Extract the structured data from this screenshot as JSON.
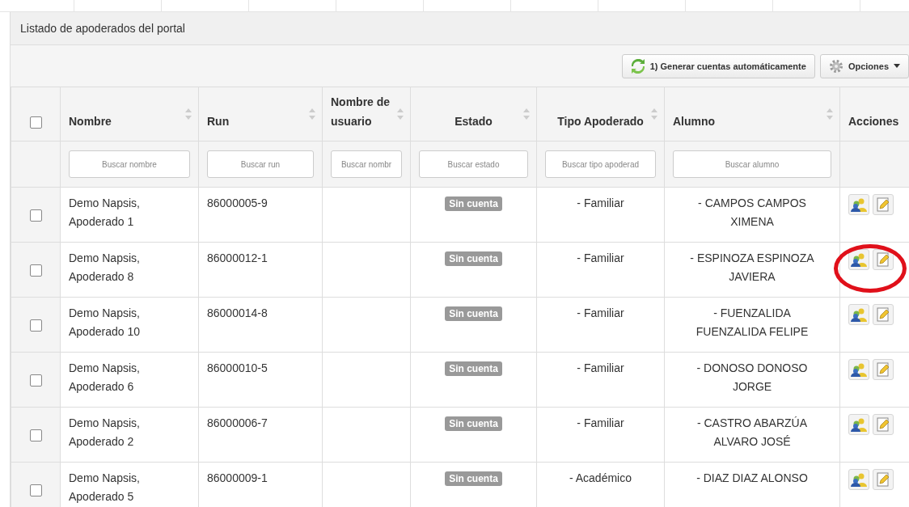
{
  "panel": {
    "title": "Listado de apoderados del portal"
  },
  "toolbar": {
    "buttons": [
      {
        "kind": "generate",
        "label": "1) Generar cuentas automáticamente"
      },
      {
        "kind": "options",
        "label": "Opciones"
      }
    ]
  },
  "table": {
    "select_all": {
      "checked": false
    },
    "columns": [
      {
        "label": "Nombre",
        "sortable": true,
        "placeholder": "Buscar nombre"
      },
      {
        "label": "Run",
        "sortable": true,
        "placeholder": "Buscar run"
      },
      {
        "label": "Nombre de usuario",
        "sortable": true,
        "placeholder": "Buscar nombr"
      },
      {
        "label": "Estado",
        "sortable": true,
        "placeholder": "Buscar estado"
      },
      {
        "label": "Tipo Apoderado",
        "sortable": true,
        "placeholder": "Buscar tipo apoderad"
      },
      {
        "label": "Alumno",
        "sortable": true,
        "placeholder": "Buscar alumno"
      },
      {
        "label": "Acciones",
        "sortable": false
      }
    ],
    "rows": [
      {
        "checked": false,
        "nombre": "Demo Napsis, Apoderado 1",
        "run": "86000005-9",
        "estado": "Sin cuenta",
        "tipo": "- Familiar",
        "alumno": "- CAMPOS CAMPOS XIMENA",
        "circled": false
      },
      {
        "checked": false,
        "nombre": "Demo Napsis, Apoderado 8",
        "run": "86000012-1",
        "estado": "Sin cuenta",
        "tipo": "- Familiar",
        "alumno": "- ESPINOZA ESPINOZA JAVIERA",
        "circled": true
      },
      {
        "checked": false,
        "nombre": "Demo Napsis, Apoderado 10",
        "run": "86000014-8",
        "estado": "Sin cuenta",
        "tipo": "- Familiar",
        "alumno": "- FUENZALIDA FUENZALIDA FELIPE",
        "circled": false
      },
      {
        "checked": false,
        "nombre": "Demo Napsis, Apoderado 6",
        "run": "86000010-5",
        "estado": "Sin cuenta",
        "tipo": "- Familiar",
        "alumno": "- DONOSO DONOSO JORGE",
        "circled": false
      },
      {
        "checked": false,
        "nombre": "Demo Napsis, Apoderado 2",
        "run": "86000006-7",
        "estado": "Sin cuenta",
        "tipo": "- Familiar",
        "alumno": "- CASTRO ABARZÚA ALVARO JOSÉ",
        "circled": false
      },
      {
        "checked": false,
        "nombre": "Demo Napsis, Apoderado 5",
        "run": "86000009-1",
        "estado": "Sin cuenta",
        "tipo": "- Académico",
        "alumno": "- DIAZ DIAZ ALONSO",
        "circled": false
      }
    ]
  }
}
